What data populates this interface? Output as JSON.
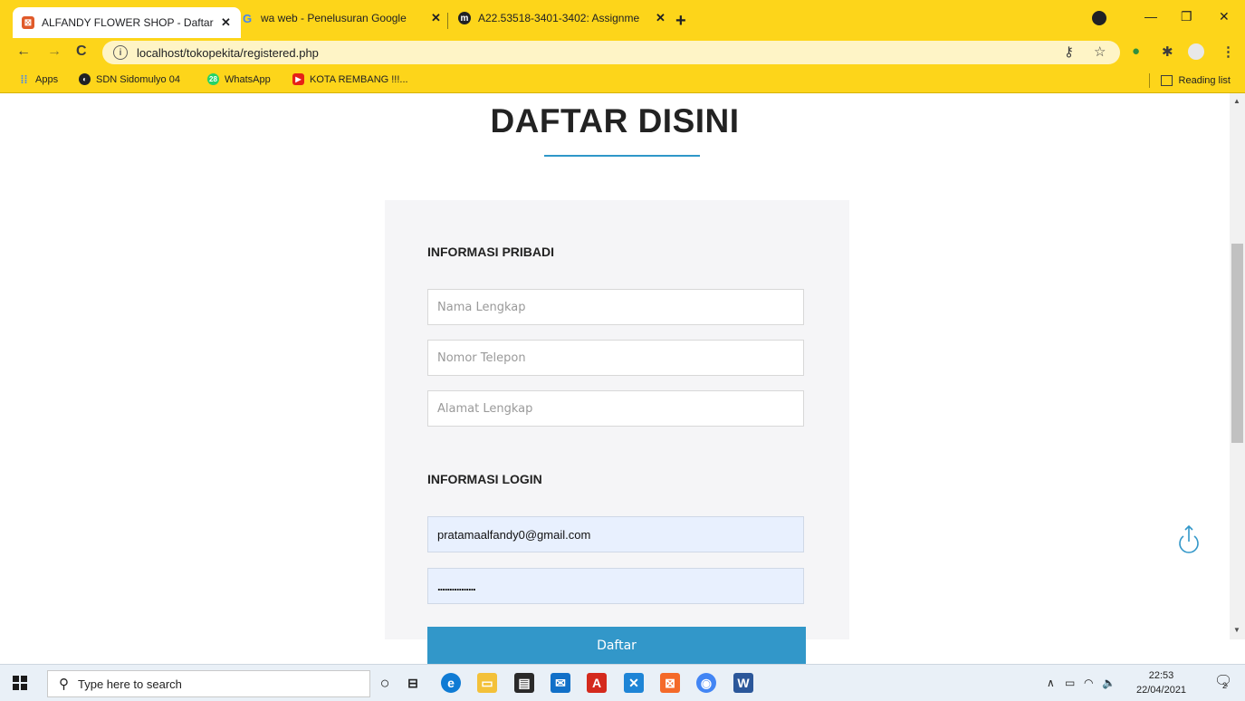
{
  "browser": {
    "tabs": [
      {
        "title": "ALFANDY FLOWER SHOP - Daftar",
        "active": true
      },
      {
        "title": "wa web - Penelusuran Google",
        "active": false
      },
      {
        "title": "A22.53518-3401-3402: Assignme",
        "active": false
      }
    ],
    "new_tab": "+",
    "url": "localhost/tokopekita/registered.php",
    "bookmarks": [
      {
        "label": "Apps"
      },
      {
        "label": "SDN Sidomulyo 04"
      },
      {
        "label": "WhatsApp"
      },
      {
        "label": "KOTA REMBANG !!!..."
      }
    ],
    "reading_list": "Reading list",
    "whatsapp_badge": "28",
    "colors": {
      "chrome": "#fdd51a",
      "accent": "#3297c9"
    }
  },
  "page": {
    "heading": "DAFTAR DISINI",
    "personal_section": "INFORMASI PRIBADI",
    "fields": {
      "name_placeholder": "Nama Lengkap",
      "phone_placeholder": "Nomor Telepon",
      "address_placeholder": "Alamat Lengkap"
    },
    "login_section": "INFORMASI LOGIN",
    "email_value": "pratamaalfandy0@gmail.com",
    "password_value": "................",
    "submit_label": "Daftar"
  },
  "taskbar": {
    "search_placeholder": "Type here to search",
    "time": "22:53",
    "date": "22/04/2021",
    "notification_count": "2"
  }
}
